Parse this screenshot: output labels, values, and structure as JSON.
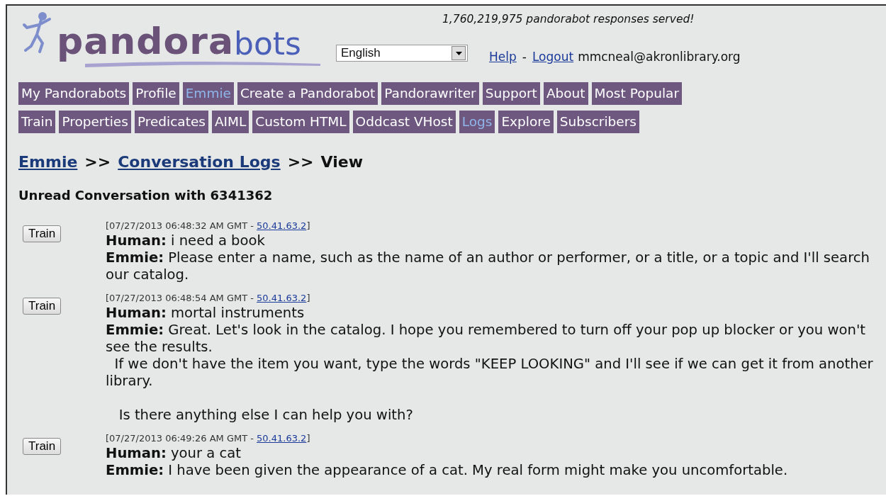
{
  "logo": {
    "part_1": "pandora",
    "part_2": "bots"
  },
  "counter": "1,760,219,975 pandorabot responses served!",
  "language_select": {
    "value": "English"
  },
  "user_links": [
    {
      "label": "Help"
    },
    {
      "label": "Logout"
    }
  ],
  "user_links_separator": "-",
  "user_email": "mmcneal@akronlibrary.org",
  "main_menu": [
    {
      "label": "My Pandorabots",
      "selected": false
    },
    {
      "label": "Profile",
      "selected": false
    },
    {
      "label": "Emmie",
      "selected": true
    },
    {
      "label": "Create a Pandorabot",
      "selected": false
    },
    {
      "label": "Pandorawriter",
      "selected": false
    },
    {
      "label": "Support",
      "selected": false
    },
    {
      "label": "About",
      "selected": false
    },
    {
      "label": "Most Popular",
      "selected": false
    }
  ],
  "bot_menu": [
    {
      "label": "Train",
      "selected": false
    },
    {
      "label": "Properties",
      "selected": false
    },
    {
      "label": "Predicates",
      "selected": false
    },
    {
      "label": "AIML",
      "selected": false
    },
    {
      "label": "Custom HTML",
      "selected": false
    },
    {
      "label": "Oddcast VHost",
      "selected": false
    },
    {
      "label": "Logs",
      "selected": true
    },
    {
      "label": "Explore",
      "selected": false
    },
    {
      "label": "Subscribers",
      "selected": false
    }
  ],
  "breadcrumb": {
    "links": [
      "Emmie",
      "Conversation Logs"
    ],
    "separator": ">>",
    "current": "View"
  },
  "heading": "Unread Conversation with 6341362",
  "messages": [
    {
      "button": "Train",
      "timestamp": "[07/27/2013 06:48:32 AM GMT - ",
      "ip": "50.41.63.2",
      "timestamp_end": "]",
      "human": "**Human:** i need a book",
      "bot": "**Emmie:** Please enter a name, such as the name of an author or performer, or a title, or a topic and I'll search our catalog."
    },
    {
      "button": "Train",
      "timestamp": "[07/27/2013 06:48:54 AM GMT - ",
      "ip": "50.41.63.2",
      "timestamp_end": "]",
      "human": "**Human:** mortal instruments",
      "bot": "**Emmie:** Great. Let's look in the catalog. I hope you remembered to turn off your pop up blocker or you won't see the results.\n  If we don't have the item you want, type the words \"KEEP LOOKING\" and I'll see if we can get it from another library.\n\n   Is there anything else I can help you with?"
    },
    {
      "button": "Train",
      "timestamp": "[07/27/2013 06:49:26 AM GMT - ",
      "ip": "50.41.63.2",
      "timestamp_end": "]",
      "human": "**Human:** your a cat",
      "bot": "**Emmie:** I have been given the appearance of a cat. My real form might make you uncomfortable."
    }
  ]
}
